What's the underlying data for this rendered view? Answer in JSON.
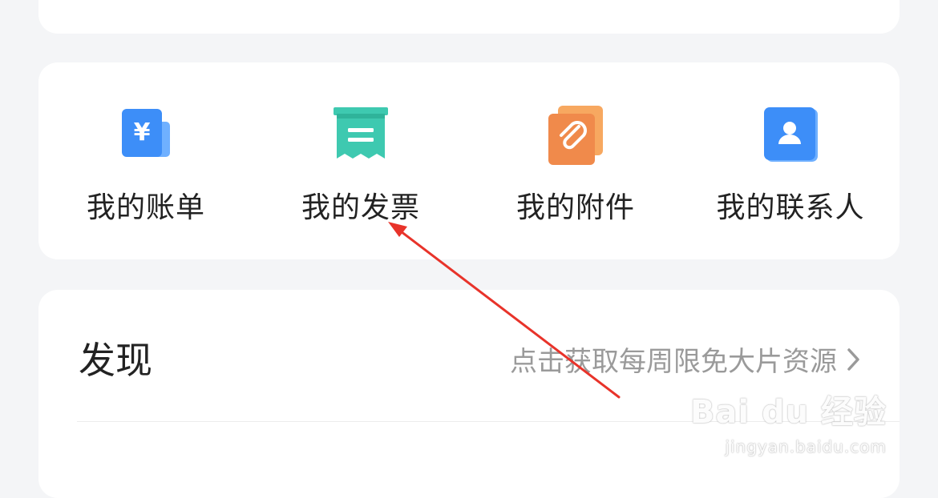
{
  "colors": {
    "background": "#f4f5f7",
    "card": "#ffffff",
    "bill_icon": "#3d8ef8",
    "invoice_icon": "#3ec9b0",
    "attachment_icon": "#f08a4b",
    "contact_icon": "#3d8ef8",
    "annotation_arrow": "#e8332a"
  },
  "grid": {
    "items": [
      {
        "label": "我的账单",
        "icon": "bill-yen-icon"
      },
      {
        "label": "我的发票",
        "icon": "invoice-receipt-icon"
      },
      {
        "label": "我的附件",
        "icon": "attachment-paperclip-icon"
      },
      {
        "label": "我的联系人",
        "icon": "contact-card-icon"
      }
    ]
  },
  "discover": {
    "title": "发现",
    "link_text": "点击获取每周限免大片资源",
    "link_icon": "chevron-right-icon"
  },
  "watermark": {
    "brand": "Bai du 经验",
    "url": "jingyan.baidu.com"
  }
}
